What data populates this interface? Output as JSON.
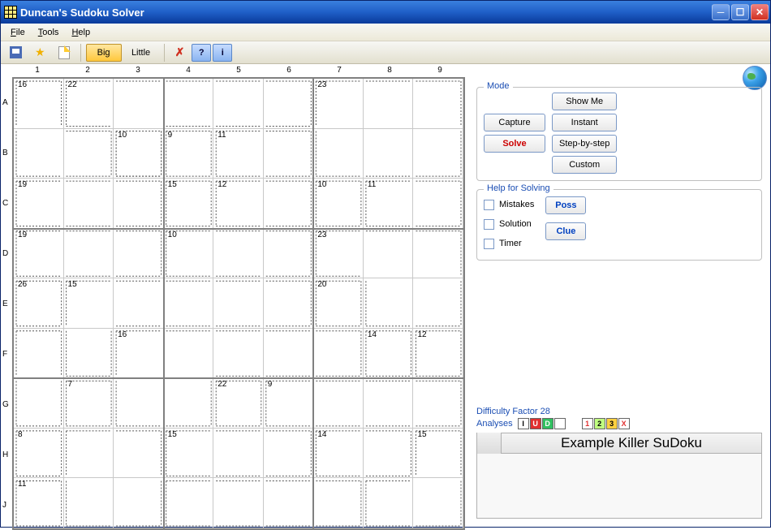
{
  "window": {
    "title": "Duncan's Sudoku Solver"
  },
  "menu": {
    "file": "File",
    "tools": "Tools",
    "help": "Help"
  },
  "toolbar": {
    "save": "save-icon",
    "star": "star-icon",
    "new": "new-icon",
    "big": "Big",
    "little": "Little",
    "clear": "clear-icon",
    "help": "?",
    "info": "i"
  },
  "grid": {
    "cols": [
      "1",
      "2",
      "3",
      "4",
      "5",
      "6",
      "7",
      "8",
      "9"
    ],
    "rows": [
      "A",
      "B",
      "C",
      "D",
      "E",
      "F",
      "G",
      "H",
      "J"
    ],
    "cage_sums": {
      "A1": "16",
      "A2": "22",
      "A7": "23",
      "B3": "10",
      "B4": "9",
      "B5": "11",
      "C1": "19",
      "C4": "15",
      "C5": "12",
      "C7": "10",
      "C8": "11",
      "D1": "19",
      "D4": "10",
      "D7": "23",
      "E1": "26",
      "E2": "15",
      "E7": "20",
      "F3": "16",
      "F8": "14",
      "F9": "12",
      "G2": "7",
      "G5": "22",
      "G6": "9",
      "H1": "8",
      "H4": "15",
      "H7": "14",
      "H9": "15",
      "J1": "11"
    }
  },
  "right": {
    "mode_legend": "Mode",
    "capture": "Capture",
    "solve": "Solve",
    "show_me": "Show Me",
    "instant": "Instant",
    "step": "Step-by-step",
    "custom": "Custom",
    "help_legend": "Help for Solving",
    "mistakes": "Mistakes",
    "solution": "Solution",
    "timer": "Timer",
    "poss": "Poss",
    "clue": "Clue",
    "difficulty": "Difficulty Factor 28",
    "analyses_label": "Analyses",
    "analyses": [
      {
        "t": "I",
        "bg": "#fff",
        "fg": "#000"
      },
      {
        "t": "U",
        "bg": "#e03030",
        "fg": "#fff"
      },
      {
        "t": "D",
        "bg": "#30c060",
        "fg": "#fff"
      },
      {
        "t": "",
        "bg": "#fff",
        "fg": "#000"
      },
      {
        "t": "1",
        "bg": "#fff",
        "fg": "#e03030"
      },
      {
        "t": "2",
        "bg": "#c0ff80",
        "fg": "#000"
      },
      {
        "t": "3",
        "bg": "#ffd040",
        "fg": "#000"
      },
      {
        "t": "X",
        "bg": "#fff",
        "fg": "#e03030"
      }
    ],
    "example_title": "Example Killer SuDoku"
  }
}
